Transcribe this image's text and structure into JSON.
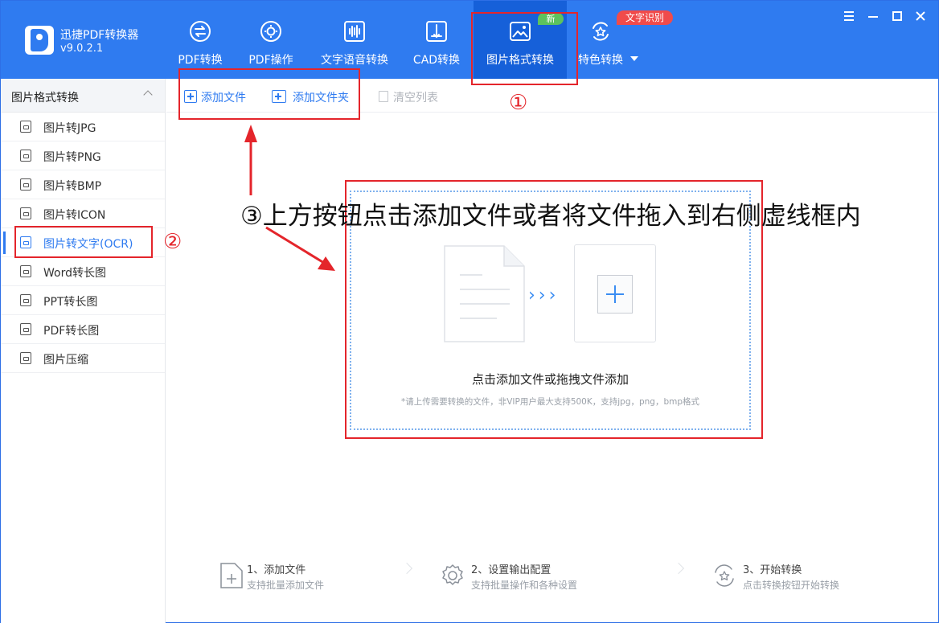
{
  "app": {
    "title": "迅捷PDF转换器",
    "version": "v9.0.2.1"
  },
  "nav": [
    {
      "label": "PDF转换",
      "icon": "pdf-convert-icon"
    },
    {
      "label": "PDF操作",
      "icon": "pdf-operate-icon"
    },
    {
      "label": "文字语音转换",
      "icon": "voice-icon"
    },
    {
      "label": "CAD转换",
      "icon": "cad-icon"
    },
    {
      "label": "图片格式转换",
      "icon": "image-icon",
      "active": true
    },
    {
      "label": "特色转换",
      "icon": "star-icon"
    }
  ],
  "badges": {
    "new": "新",
    "ocr": "文字识别"
  },
  "sidebar": {
    "header": "图片格式转换",
    "items": [
      {
        "label": "图片转JPG"
      },
      {
        "label": "图片转PNG"
      },
      {
        "label": "图片转BMP"
      },
      {
        "label": "图片转ICON"
      },
      {
        "label": "图片转文字(OCR)",
        "active": true
      },
      {
        "label": "Word转长图"
      },
      {
        "label": "PPT转长图"
      },
      {
        "label": "PDF转长图"
      },
      {
        "label": "图片压缩"
      }
    ]
  },
  "toolbar": {
    "add_file": "添加文件",
    "add_folder": "添加文件夹",
    "clear_list": "清空列表"
  },
  "annotations": {
    "marker1": "①",
    "marker2": "②",
    "instruction": "③上方按钮点击添加文件或者将文件拖入到右侧虚线框内"
  },
  "dropzone": {
    "title": "点击添加文件或拖拽文件添加",
    "hint": "*请上传需要转换的文件，非VIP用户最大支持500K，支持jpg，png，bmp格式",
    "chevrons": "›››"
  },
  "steps": [
    {
      "title": "1、添加文件",
      "sub": "支持批量添加文件"
    },
    {
      "title": "2、设置输出配置",
      "sub": "支持批量操作和各种设置"
    },
    {
      "title": "3、开始转换",
      "sub": "点击转换按钮开始转换"
    }
  ],
  "colors": {
    "brand": "#2f7bf0",
    "active_nav": "#1660d9",
    "annotation": "#e4252b"
  }
}
